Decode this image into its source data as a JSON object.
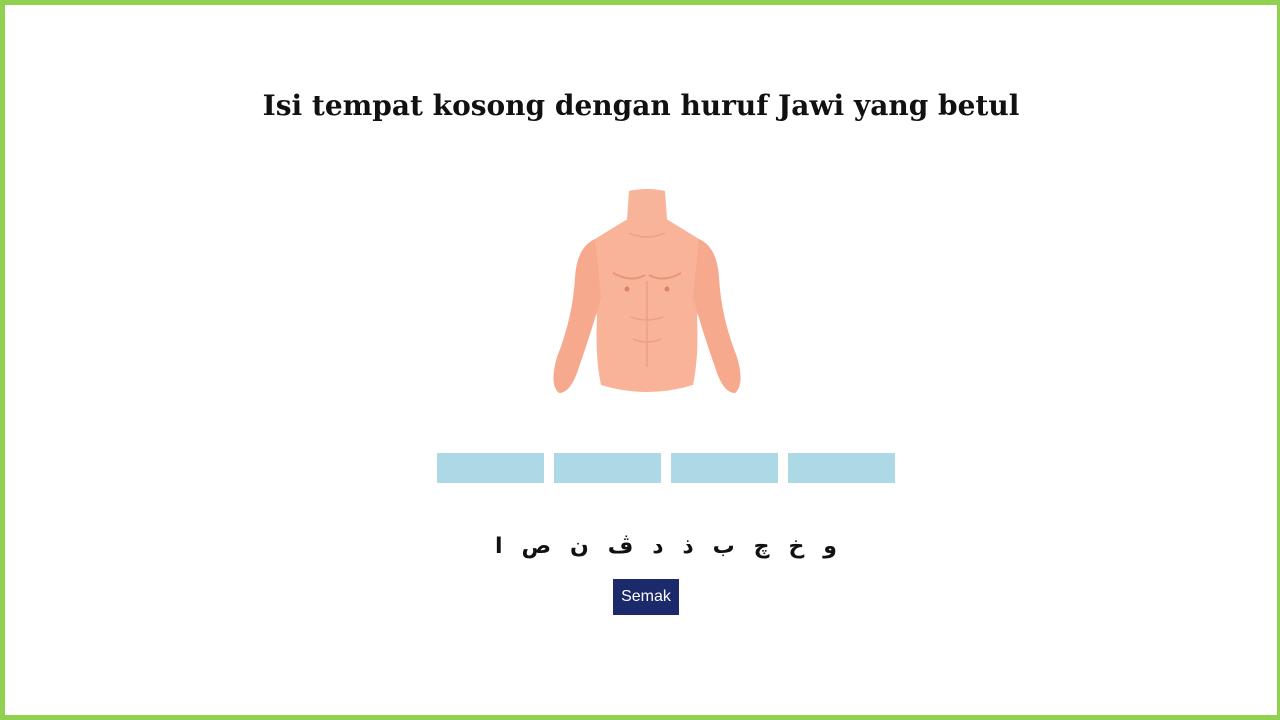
{
  "header": {
    "title": "Isi tempat kosong dengan huruf Jawi yang betul"
  },
  "picture": {
    "icon": "torso-illustration"
  },
  "answer_slots": [
    {
      "value": ""
    },
    {
      "value": ""
    },
    {
      "value": ""
    },
    {
      "value": ""
    }
  ],
  "letter_bank": [
    "و",
    "خ",
    "چ",
    "ب",
    "ذ",
    "د",
    "ڤ",
    "ن",
    "ص",
    "ا"
  ],
  "actions": {
    "check_label": "Semak"
  },
  "colors": {
    "frame_border": "#92d050",
    "slot_fill": "#add8e6",
    "button_fill": "#1b2a6b"
  }
}
